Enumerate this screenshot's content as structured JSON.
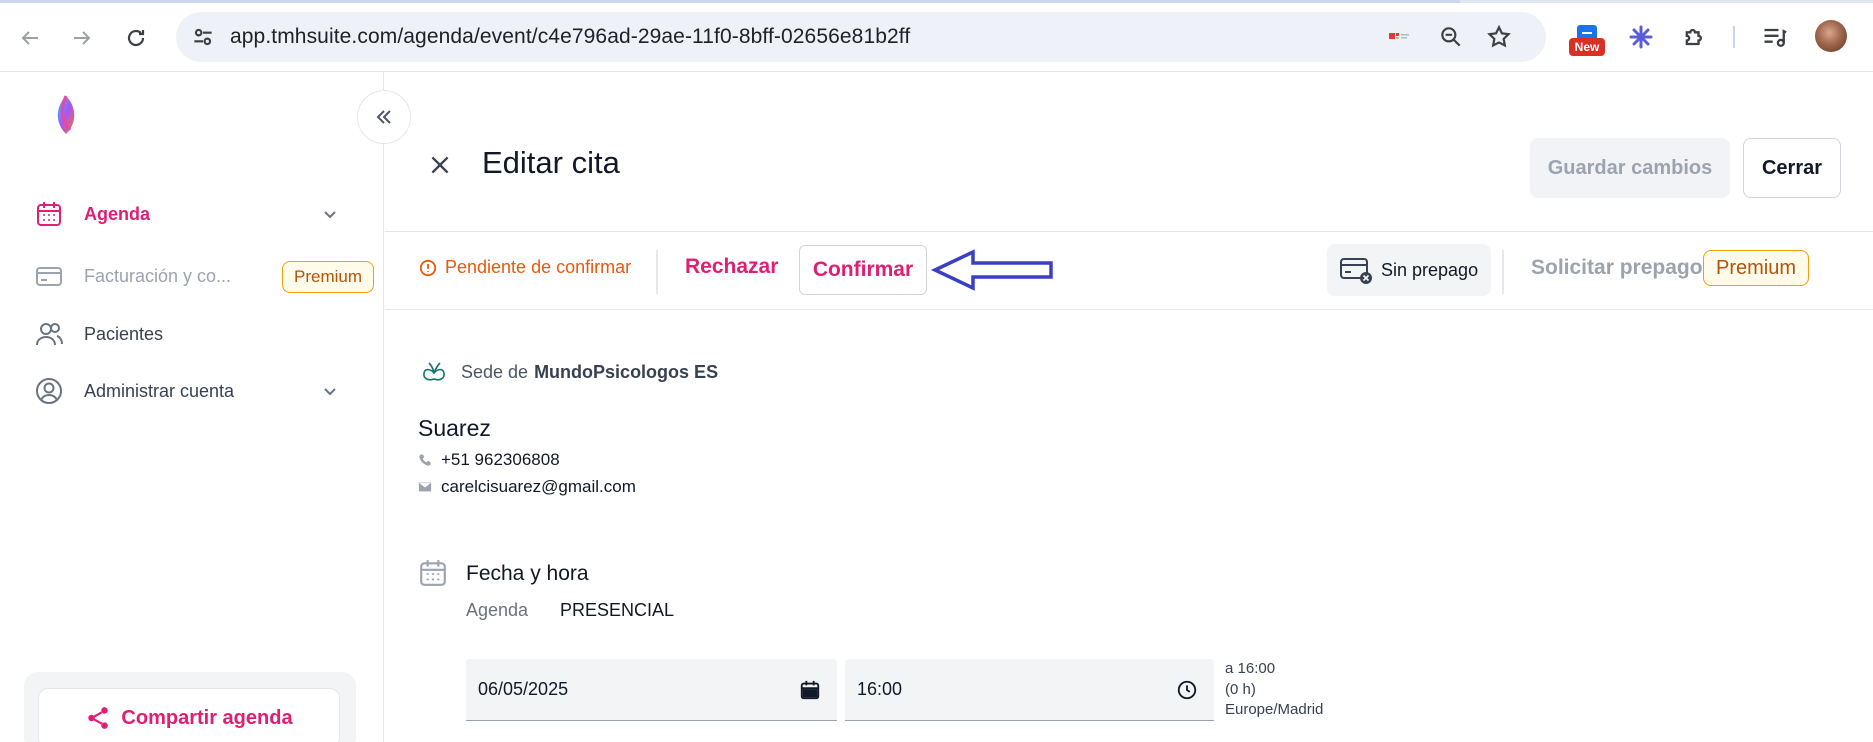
{
  "browser": {
    "url": "app.tmhsuite.com/agenda/event/c4e796ad-29ae-11f0-8bff-02656e81b2ff",
    "new_badge": "New"
  },
  "sidebar": {
    "items": [
      {
        "label": "Agenda",
        "icon": "calendar-icon",
        "active": true,
        "expandable": true
      },
      {
        "label": "Facturación y co...",
        "icon": "credit-card-icon",
        "badge": "Premium",
        "disabled": true
      },
      {
        "label": "Pacientes",
        "icon": "users-icon"
      },
      {
        "label": "Administrar cuenta",
        "icon": "user-circle-icon",
        "expandable": true
      }
    ],
    "share_label": "Compartir agenda"
  },
  "header": {
    "title": "Editar cita",
    "save_label": "Guardar cambios",
    "close_label": "Cerrar"
  },
  "actions": {
    "status": "Pendiente de confirmar",
    "reject_label": "Rechazar",
    "confirm_label": "Confirmar",
    "prepago_status": "Sin prepago",
    "request_prepago_label": "Solicitar prepago",
    "premium_badge": "Premium"
  },
  "appointment": {
    "sede_prefix": "Sede de",
    "sede_name": "MundoPsicologos ES",
    "patient_name": "Suarez",
    "phone": "+51 962306808",
    "email": "carelcisuarez@gmail.com",
    "section_title": "Fecha y hora",
    "agenda_label": "Agenda",
    "agenda_value": "PRESENCIAL",
    "date": "06/05/2025",
    "time": "16:00",
    "end_time": "a 16:00",
    "duration": "(0 h)",
    "timezone": "Europe/Madrid"
  },
  "colors": {
    "brand": "#e11d74",
    "warning": "#ea580c",
    "premium": "#b45309",
    "annotation_arrow": "#3b3fc4"
  }
}
